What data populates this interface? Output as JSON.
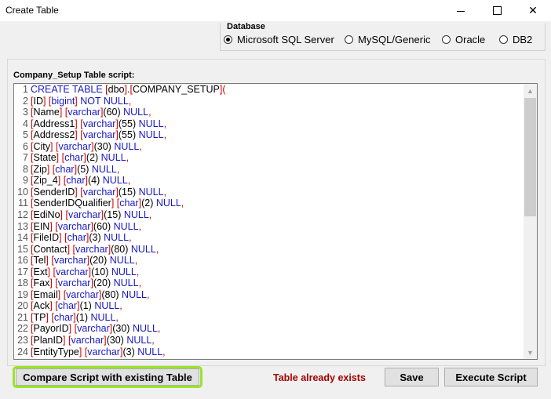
{
  "window": {
    "title": "Create Table",
    "min_icon": "minimize-icon",
    "max_icon": "maximize-icon",
    "close_icon": "close-icon",
    "close_glyph": "✕"
  },
  "database": {
    "legend": "Database",
    "options": [
      "Microsoft SQL Server",
      "MySQL/Generic",
      "Oracle",
      "DB2"
    ],
    "selected": "Microsoft SQL Server"
  },
  "script": {
    "label": "Company_Setup Table script:",
    "lines": [
      {
        "n": "1",
        "t": [
          [
            "kw",
            "CREATE TABLE "
          ],
          [
            "punct",
            "["
          ],
          [
            "ident",
            "dbo"
          ],
          [
            "punct",
            "]"
          ],
          [
            "ident",
            "."
          ],
          [
            "punct",
            "["
          ],
          [
            "ident",
            "COMPANY_SETUP"
          ],
          [
            "punct",
            "]("
          ]
        ]
      },
      {
        "n": "2",
        "t": [
          [
            "punct",
            "["
          ],
          [
            "ident",
            "ID"
          ],
          [
            "punct",
            "] ["
          ],
          [
            "type",
            "bigint"
          ],
          [
            "punct",
            "] "
          ],
          [
            "kw",
            "NOT NULL"
          ],
          [
            "punct",
            ","
          ]
        ]
      },
      {
        "n": "3",
        "t": [
          [
            "punct",
            "["
          ],
          [
            "ident",
            "Name"
          ],
          [
            "punct",
            "] ["
          ],
          [
            "type",
            "varchar"
          ],
          [
            "punct",
            "]"
          ],
          [
            "num",
            "(60) "
          ],
          [
            "kw",
            "NULL"
          ],
          [
            "punct",
            ","
          ]
        ]
      },
      {
        "n": "4",
        "t": [
          [
            "punct",
            "["
          ],
          [
            "ident",
            "Address1"
          ],
          [
            "punct",
            "] ["
          ],
          [
            "type",
            "varchar"
          ],
          [
            "punct",
            "]"
          ],
          [
            "num",
            "(55) "
          ],
          [
            "kw",
            "NULL"
          ],
          [
            "punct",
            ","
          ]
        ]
      },
      {
        "n": "5",
        "t": [
          [
            "punct",
            "["
          ],
          [
            "ident",
            "Address2"
          ],
          [
            "punct",
            "] ["
          ],
          [
            "type",
            "varchar"
          ],
          [
            "punct",
            "]"
          ],
          [
            "num",
            "(55) "
          ],
          [
            "kw",
            "NULL"
          ],
          [
            "punct",
            ","
          ]
        ]
      },
      {
        "n": "6",
        "t": [
          [
            "punct",
            "["
          ],
          [
            "ident",
            "City"
          ],
          [
            "punct",
            "] ["
          ],
          [
            "type",
            "varchar"
          ],
          [
            "punct",
            "]"
          ],
          [
            "num",
            "(30) "
          ],
          [
            "kw",
            "NULL"
          ],
          [
            "punct",
            ","
          ]
        ]
      },
      {
        "n": "7",
        "t": [
          [
            "punct",
            "["
          ],
          [
            "ident",
            "State"
          ],
          [
            "punct",
            "] ["
          ],
          [
            "type",
            "char"
          ],
          [
            "punct",
            "]"
          ],
          [
            "num",
            "(2) "
          ],
          [
            "kw",
            "NULL"
          ],
          [
            "punct",
            ","
          ]
        ]
      },
      {
        "n": "8",
        "t": [
          [
            "punct",
            "["
          ],
          [
            "ident",
            "Zip"
          ],
          [
            "punct",
            "] ["
          ],
          [
            "type",
            "char"
          ],
          [
            "punct",
            "]"
          ],
          [
            "num",
            "(5) "
          ],
          [
            "kw",
            "NULL"
          ],
          [
            "punct",
            ","
          ]
        ]
      },
      {
        "n": "9",
        "t": [
          [
            "punct",
            "["
          ],
          [
            "ident",
            "Zip_4"
          ],
          [
            "punct",
            "] ["
          ],
          [
            "type",
            "char"
          ],
          [
            "punct",
            "]"
          ],
          [
            "num",
            "(4) "
          ],
          [
            "kw",
            "NULL"
          ],
          [
            "punct",
            ","
          ]
        ]
      },
      {
        "n": "10",
        "t": [
          [
            "punct",
            "["
          ],
          [
            "ident",
            "SenderID"
          ],
          [
            "punct",
            "] ["
          ],
          [
            "type",
            "varchar"
          ],
          [
            "punct",
            "]"
          ],
          [
            "num",
            "(15) "
          ],
          [
            "kw",
            "NULL"
          ],
          [
            "punct",
            ","
          ]
        ]
      },
      {
        "n": "11",
        "t": [
          [
            "punct",
            "["
          ],
          [
            "ident",
            "SenderIDQualifier"
          ],
          [
            "punct",
            "] ["
          ],
          [
            "type",
            "char"
          ],
          [
            "punct",
            "]"
          ],
          [
            "num",
            "(2) "
          ],
          [
            "kw",
            "NULL"
          ],
          [
            "punct",
            ","
          ]
        ]
      },
      {
        "n": "12",
        "t": [
          [
            "punct",
            "["
          ],
          [
            "ident",
            "EdiNo"
          ],
          [
            "punct",
            "] ["
          ],
          [
            "type",
            "varchar"
          ],
          [
            "punct",
            "]"
          ],
          [
            "num",
            "(15) "
          ],
          [
            "kw",
            "NULL"
          ],
          [
            "punct",
            ","
          ]
        ]
      },
      {
        "n": "13",
        "t": [
          [
            "punct",
            "["
          ],
          [
            "ident",
            "EIN"
          ],
          [
            "punct",
            "] ["
          ],
          [
            "type",
            "varchar"
          ],
          [
            "punct",
            "]"
          ],
          [
            "num",
            "(60) "
          ],
          [
            "kw",
            "NULL"
          ],
          [
            "punct",
            ","
          ]
        ]
      },
      {
        "n": "14",
        "t": [
          [
            "punct",
            "["
          ],
          [
            "ident",
            "FileID"
          ],
          [
            "punct",
            "] ["
          ],
          [
            "type",
            "char"
          ],
          [
            "punct",
            "]"
          ],
          [
            "num",
            "(3) "
          ],
          [
            "kw",
            "NULL"
          ],
          [
            "punct",
            ","
          ]
        ]
      },
      {
        "n": "15",
        "t": [
          [
            "punct",
            "["
          ],
          [
            "ident",
            "Contact"
          ],
          [
            "punct",
            "] ["
          ],
          [
            "type",
            "varchar"
          ],
          [
            "punct",
            "]"
          ],
          [
            "num",
            "(80) "
          ],
          [
            "kw",
            "NULL"
          ],
          [
            "punct",
            ","
          ]
        ]
      },
      {
        "n": "16",
        "t": [
          [
            "punct",
            "["
          ],
          [
            "ident",
            "Tel"
          ],
          [
            "punct",
            "] ["
          ],
          [
            "type",
            "varchar"
          ],
          [
            "punct",
            "]"
          ],
          [
            "num",
            "(20) "
          ],
          [
            "kw",
            "NULL"
          ],
          [
            "punct",
            ","
          ]
        ]
      },
      {
        "n": "17",
        "t": [
          [
            "punct",
            "["
          ],
          [
            "ident",
            "Ext"
          ],
          [
            "punct",
            "] ["
          ],
          [
            "type",
            "varchar"
          ],
          [
            "punct",
            "]"
          ],
          [
            "num",
            "(10) "
          ],
          [
            "kw",
            "NULL"
          ],
          [
            "punct",
            ","
          ]
        ]
      },
      {
        "n": "18",
        "t": [
          [
            "punct",
            "["
          ],
          [
            "ident",
            "Fax"
          ],
          [
            "punct",
            "] ["
          ],
          [
            "type",
            "varchar"
          ],
          [
            "punct",
            "]"
          ],
          [
            "num",
            "(20) "
          ],
          [
            "kw",
            "NULL"
          ],
          [
            "punct",
            ","
          ]
        ]
      },
      {
        "n": "19",
        "t": [
          [
            "punct",
            "["
          ],
          [
            "ident",
            "Email"
          ],
          [
            "punct",
            "] ["
          ],
          [
            "type",
            "varchar"
          ],
          [
            "punct",
            "]"
          ],
          [
            "num",
            "(80) "
          ],
          [
            "kw",
            "NULL"
          ],
          [
            "punct",
            ","
          ]
        ]
      },
      {
        "n": "20",
        "t": [
          [
            "punct",
            "["
          ],
          [
            "ident",
            "Ack"
          ],
          [
            "punct",
            "] ["
          ],
          [
            "type",
            "char"
          ],
          [
            "punct",
            "]"
          ],
          [
            "num",
            "(1) "
          ],
          [
            "kw",
            "NULL"
          ],
          [
            "punct",
            ","
          ]
        ]
      },
      {
        "n": "21",
        "t": [
          [
            "punct",
            "["
          ],
          [
            "ident",
            "TP"
          ],
          [
            "punct",
            "] ["
          ],
          [
            "type",
            "char"
          ],
          [
            "punct",
            "]"
          ],
          [
            "num",
            "(1) "
          ],
          [
            "kw",
            "NULL"
          ],
          [
            "punct",
            ","
          ]
        ]
      },
      {
        "n": "22",
        "t": [
          [
            "punct",
            "["
          ],
          [
            "ident",
            "PayorID"
          ],
          [
            "punct",
            "] ["
          ],
          [
            "type",
            "varchar"
          ],
          [
            "punct",
            "]"
          ],
          [
            "num",
            "(30) "
          ],
          [
            "kw",
            "NULL"
          ],
          [
            "punct",
            ","
          ]
        ]
      },
      {
        "n": "23",
        "t": [
          [
            "punct",
            "["
          ],
          [
            "ident",
            "PlanID"
          ],
          [
            "punct",
            "] ["
          ],
          [
            "type",
            "varchar"
          ],
          [
            "punct",
            "]"
          ],
          [
            "num",
            "(30) "
          ],
          [
            "kw",
            "NULL"
          ],
          [
            "punct",
            ","
          ]
        ]
      },
      {
        "n": "24",
        "t": [
          [
            "punct",
            "["
          ],
          [
            "ident",
            "EntityType"
          ],
          [
            "punct",
            "] ["
          ],
          [
            "type",
            "varchar"
          ],
          [
            "punct",
            "]"
          ],
          [
            "num",
            "(3) "
          ],
          [
            "kw",
            "NULL"
          ],
          [
            "punct",
            ","
          ]
        ]
      }
    ]
  },
  "actions": {
    "compare_label": "Compare Script with existing Table",
    "status_text": "Table already exists",
    "save_label": "Save",
    "execute_label": "Execute Script"
  },
  "colors": {
    "status": "#a40000",
    "highlight": "#9be42a",
    "keyword": "#1818c0",
    "punct": "#d00000"
  }
}
